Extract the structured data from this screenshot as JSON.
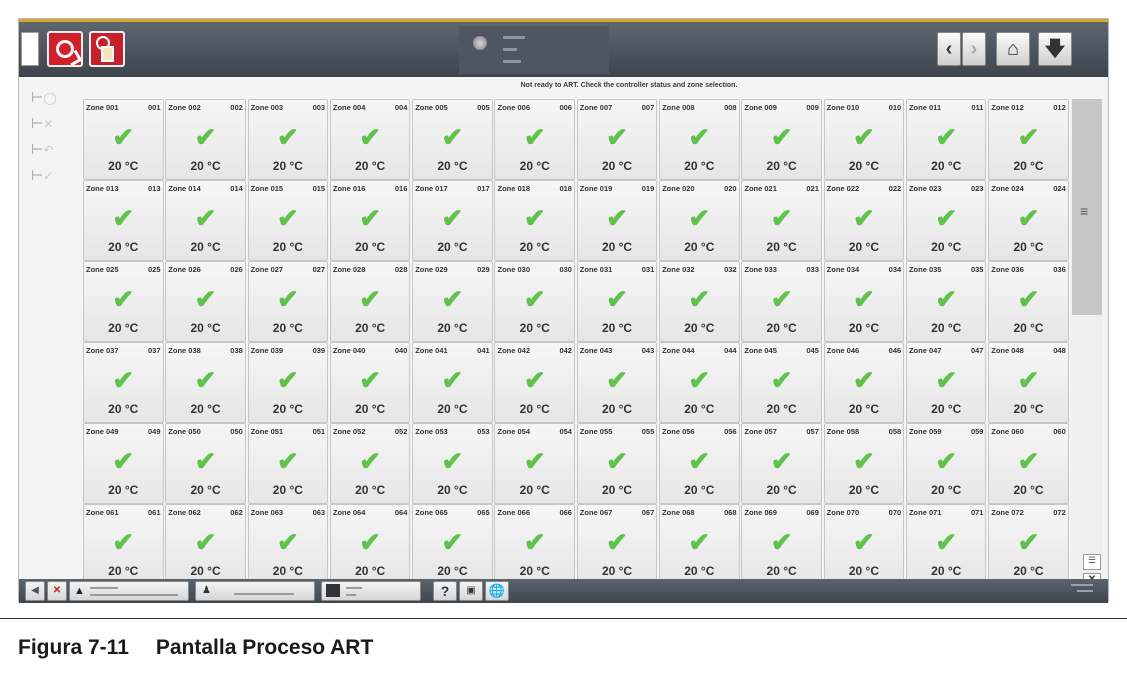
{
  "notice": "Not ready to ART. Check the controller status and zone selection.",
  "zones": [
    {
      "name": "Zone 001",
      "code": "001",
      "temp": "20 °C"
    },
    {
      "name": "Zone 002",
      "code": "002",
      "temp": "20 °C"
    },
    {
      "name": "Zone 003",
      "code": "003",
      "temp": "20 °C"
    },
    {
      "name": "Zone 004",
      "code": "004",
      "temp": "20 °C"
    },
    {
      "name": "Zone 005",
      "code": "005",
      "temp": "20 °C"
    },
    {
      "name": "Zone 006",
      "code": "006",
      "temp": "20 °C"
    },
    {
      "name": "Zone 007",
      "code": "007",
      "temp": "20 °C"
    },
    {
      "name": "Zone 008",
      "code": "008",
      "temp": "20 °C"
    },
    {
      "name": "Zone 009",
      "code": "009",
      "temp": "20 °C"
    },
    {
      "name": "Zone 010",
      "code": "010",
      "temp": "20 °C"
    },
    {
      "name": "Zone 011",
      "code": "011",
      "temp": "20 °C"
    },
    {
      "name": "Zone 012",
      "code": "012",
      "temp": "20 °C"
    },
    {
      "name": "Zone 013",
      "code": "013",
      "temp": "20 °C"
    },
    {
      "name": "Zone 014",
      "code": "014",
      "temp": "20 °C"
    },
    {
      "name": "Zone 015",
      "code": "015",
      "temp": "20 °C"
    },
    {
      "name": "Zone 016",
      "code": "016",
      "temp": "20 °C"
    },
    {
      "name": "Zone 017",
      "code": "017",
      "temp": "20 °C"
    },
    {
      "name": "Zone 018",
      "code": "018",
      "temp": "20 °C"
    },
    {
      "name": "Zone 019",
      "code": "019",
      "temp": "20 °C"
    },
    {
      "name": "Zone 020",
      "code": "020",
      "temp": "20 °C"
    },
    {
      "name": "Zone 021",
      "code": "021",
      "temp": "20 °C"
    },
    {
      "name": "Zone 022",
      "code": "022",
      "temp": "20 °C"
    },
    {
      "name": "Zone 023",
      "code": "023",
      "temp": "20 °C"
    },
    {
      "name": "Zone 024",
      "code": "024",
      "temp": "20 °C"
    },
    {
      "name": "Zone 025",
      "code": "025",
      "temp": "20 °C"
    },
    {
      "name": "Zone 026",
      "code": "026",
      "temp": "20 °C"
    },
    {
      "name": "Zone 027",
      "code": "027",
      "temp": "20 °C"
    },
    {
      "name": "Zone 028",
      "code": "028",
      "temp": "20 °C"
    },
    {
      "name": "Zone 029",
      "code": "029",
      "temp": "20 °C"
    },
    {
      "name": "Zone 030",
      "code": "030",
      "temp": "20 °C"
    },
    {
      "name": "Zone 031",
      "code": "031",
      "temp": "20 °C"
    },
    {
      "name": "Zone 032",
      "code": "032",
      "temp": "20 °C"
    },
    {
      "name": "Zone 033",
      "code": "033",
      "temp": "20 °C"
    },
    {
      "name": "Zone 034",
      "code": "034",
      "temp": "20 °C"
    },
    {
      "name": "Zone 035",
      "code": "035",
      "temp": "20 °C"
    },
    {
      "name": "Zone 036",
      "code": "036",
      "temp": "20 °C"
    },
    {
      "name": "Zone 037",
      "code": "037",
      "temp": "20 °C"
    },
    {
      "name": "Zone 038",
      "code": "038",
      "temp": "20 °C"
    },
    {
      "name": "Zone 039",
      "code": "039",
      "temp": "20 °C"
    },
    {
      "name": "Zone 040",
      "code": "040",
      "temp": "20 °C"
    },
    {
      "name": "Zone 041",
      "code": "041",
      "temp": "20 °C"
    },
    {
      "name": "Zone 042",
      "code": "042",
      "temp": "20 °C"
    },
    {
      "name": "Zone 043",
      "code": "043",
      "temp": "20 °C"
    },
    {
      "name": "Zone 044",
      "code": "044",
      "temp": "20 °C"
    },
    {
      "name": "Zone 045",
      "code": "045",
      "temp": "20 °C"
    },
    {
      "name": "Zone 046",
      "code": "046",
      "temp": "20 °C"
    },
    {
      "name": "Zone 047",
      "code": "047",
      "temp": "20 °C"
    },
    {
      "name": "Zone 048",
      "code": "048",
      "temp": "20 °C"
    },
    {
      "name": "Zone 049",
      "code": "049",
      "temp": "20 °C"
    },
    {
      "name": "Zone 050",
      "code": "050",
      "temp": "20 °C"
    },
    {
      "name": "Zone 051",
      "code": "051",
      "temp": "20 °C"
    },
    {
      "name": "Zone 052",
      "code": "052",
      "temp": "20 °C"
    },
    {
      "name": "Zone 053",
      "code": "053",
      "temp": "20 °C"
    },
    {
      "name": "Zone 054",
      "code": "054",
      "temp": "20 °C"
    },
    {
      "name": "Zone 055",
      "code": "055",
      "temp": "20 °C"
    },
    {
      "name": "Zone 056",
      "code": "056",
      "temp": "20 °C"
    },
    {
      "name": "Zone 057",
      "code": "057",
      "temp": "20 °C"
    },
    {
      "name": "Zone 058",
      "code": "058",
      "temp": "20 °C"
    },
    {
      "name": "Zone 059",
      "code": "059",
      "temp": "20 °C"
    },
    {
      "name": "Zone 060",
      "code": "060",
      "temp": "20 °C"
    },
    {
      "name": "Zone 061",
      "code": "061",
      "temp": "20 °C"
    },
    {
      "name": "Zone 062",
      "code": "062",
      "temp": "20 °C"
    },
    {
      "name": "Zone 063",
      "code": "063",
      "temp": "20 °C"
    },
    {
      "name": "Zone 064",
      "code": "064",
      "temp": "20 °C"
    },
    {
      "name": "Zone 065",
      "code": "065",
      "temp": "20 °C"
    },
    {
      "name": "Zone 066",
      "code": "066",
      "temp": "20 °C"
    },
    {
      "name": "Zone 067",
      "code": "067",
      "temp": "20 °C"
    },
    {
      "name": "Zone 068",
      "code": "068",
      "temp": "20 °C"
    },
    {
      "name": "Zone 069",
      "code": "069",
      "temp": "20 °C"
    },
    {
      "name": "Zone 070",
      "code": "070",
      "temp": "20 °C"
    },
    {
      "name": "Zone 071",
      "code": "071",
      "temp": "20 °C"
    },
    {
      "name": "Zone 072",
      "code": "072",
      "temp": "20 °C"
    }
  ],
  "zone_status_icon": "check-icon",
  "colors": {
    "accent_red": "#d21f2a",
    "topbar": "#4a525b",
    "check_green": "#5fc24a",
    "top_border": "#d8a72a"
  },
  "caption": {
    "number": "Figura 7-11",
    "title": "Pantalla Proceso ART"
  }
}
